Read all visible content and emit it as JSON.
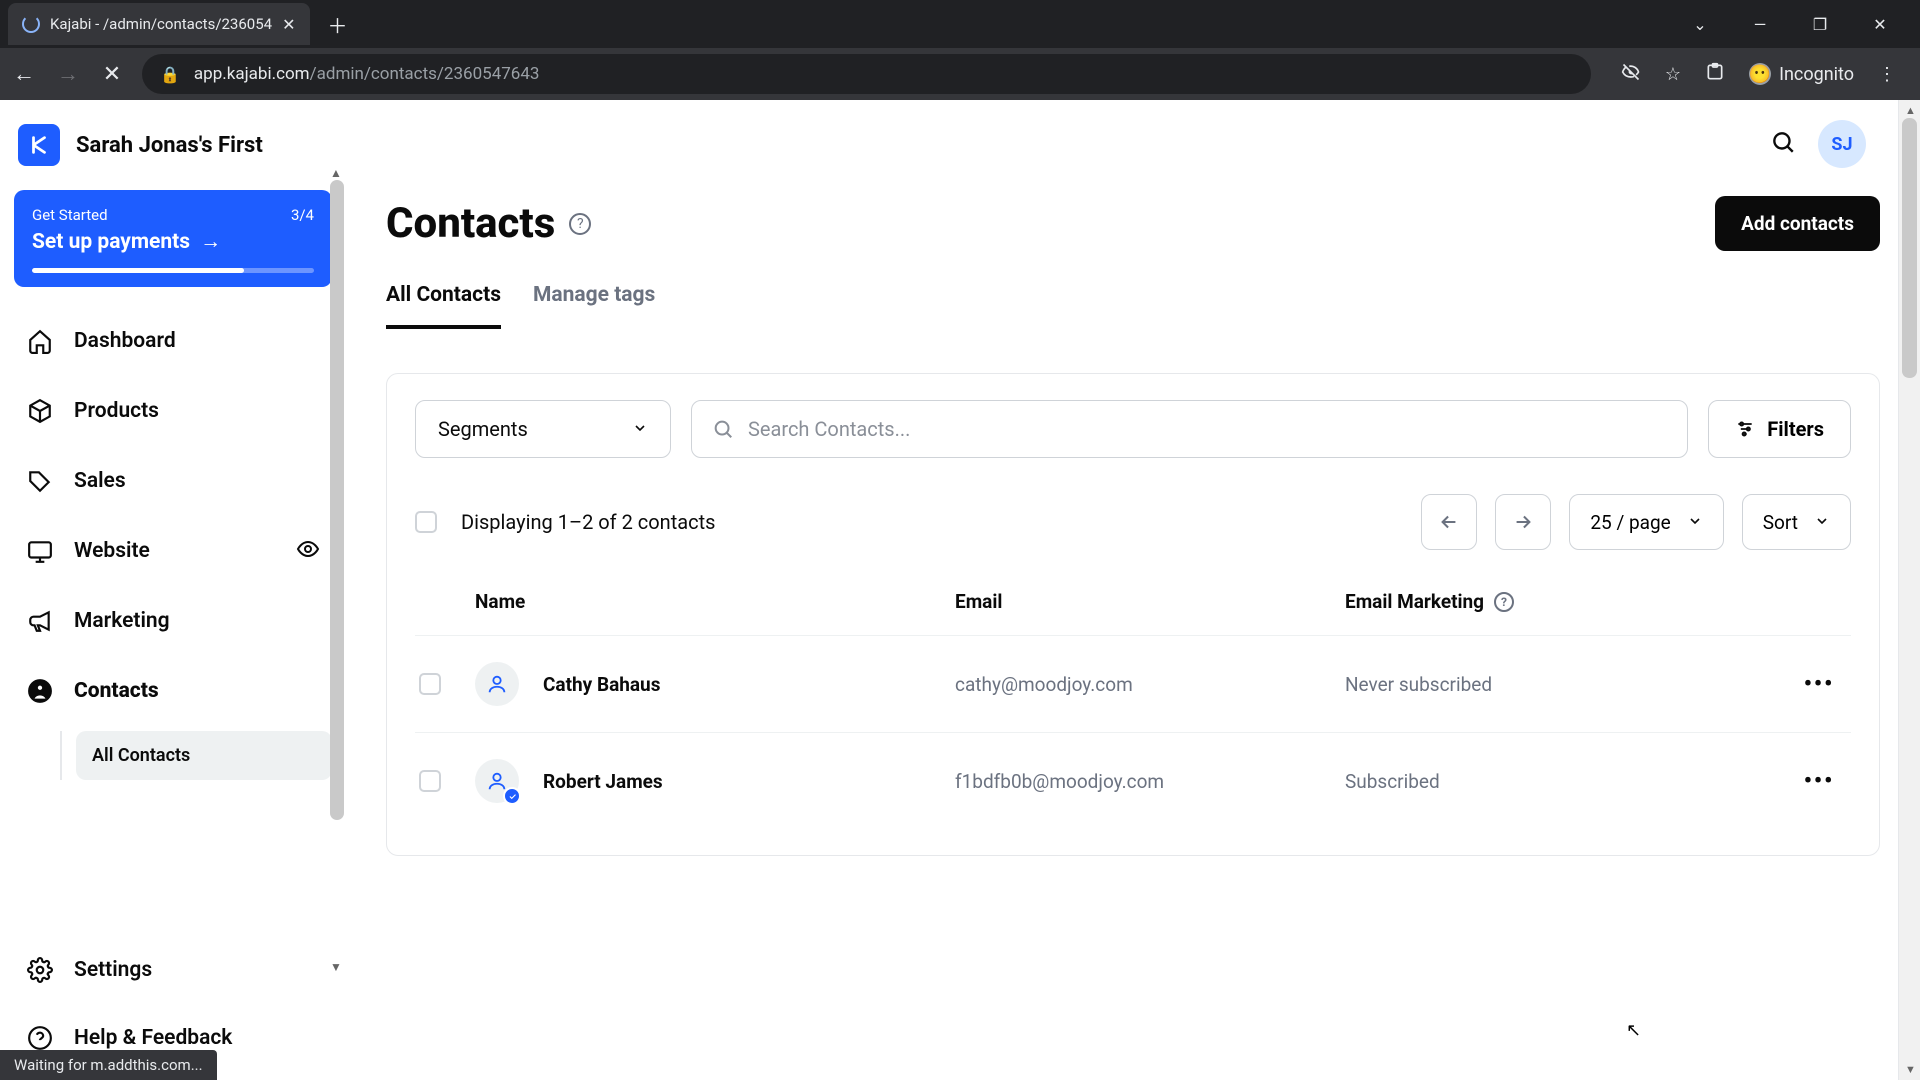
{
  "browser": {
    "tab_title": "Kajabi - /admin/contacts/236054",
    "url_host": "app.kajabi.com",
    "url_path": "/admin/contacts/2360547643",
    "incognito_label": "Incognito",
    "status_text": "Waiting for m.addthis.com..."
  },
  "brand": {
    "name": "Sarah Jonas's First"
  },
  "get_started": {
    "label": "Get Started",
    "progress": "3/4",
    "action": "Set up payments"
  },
  "nav": {
    "dashboard": "Dashboard",
    "products": "Products",
    "sales": "Sales",
    "website": "Website",
    "marketing": "Marketing",
    "contacts": "Contacts",
    "settings": "Settings",
    "help": "Help & Feedback"
  },
  "subnav": {
    "all_contacts": "All Contacts"
  },
  "topbar": {
    "avatar_initials": "SJ"
  },
  "page": {
    "title": "Contacts",
    "add_button": "Add contacts",
    "tabs": {
      "all": "All Contacts",
      "manage_tags": "Manage tags"
    }
  },
  "toolbar": {
    "segments_label": "Segments",
    "search_placeholder": "Search Contacts...",
    "filters_label": "Filters"
  },
  "list": {
    "displaying": "Displaying 1–2 of 2 contacts",
    "per_page": "25 / page",
    "sort": "Sort",
    "columns": {
      "name": "Name",
      "email": "Email",
      "marketing": "Email Marketing"
    },
    "rows": [
      {
        "name": "Cathy Bahaus",
        "email": "cathy@moodjoy.com",
        "status": "Never subscribed",
        "verified": false
      },
      {
        "name": "Robert James",
        "email": "f1bdfb0b@moodjoy.com",
        "status": "Subscribed",
        "verified": true
      }
    ]
  }
}
